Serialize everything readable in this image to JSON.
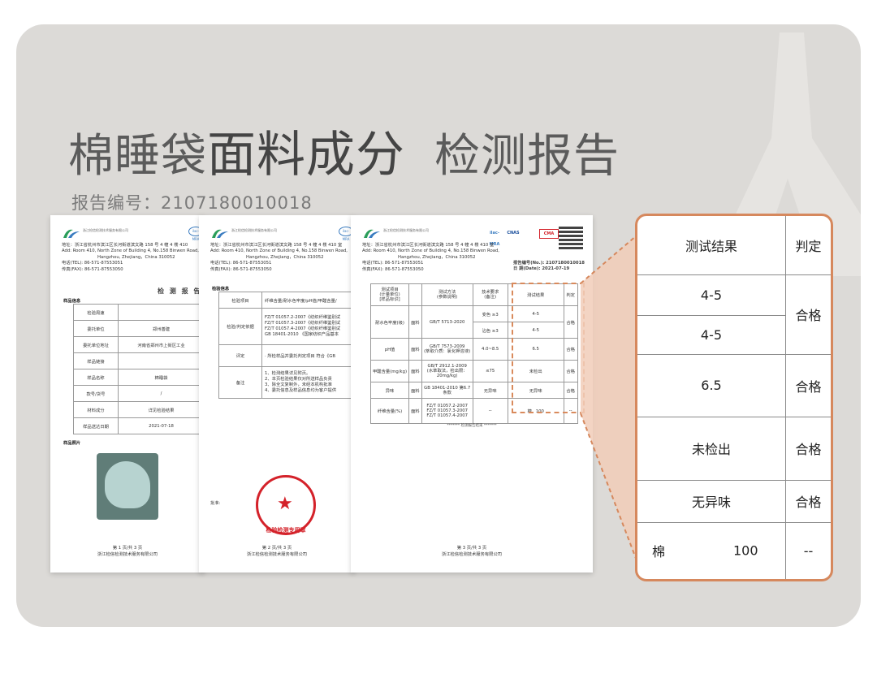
{
  "header": {
    "title_part1": "棉睡袋",
    "title_part2": "面料成分",
    "title_part3": "检测报告",
    "report_number": "报告编号：2107180010018"
  },
  "page1": {
    "lab_name": "浙江检信检测技术服务有限公司",
    "ilac": "ilac-MRA",
    "address_cn": "地址：浙江省杭州市滨江区长河街道滨文路 158 号 4 幢 4 楼 410",
    "address_en1": "Add: Room 410, North Zone of Building 4, No.158 Binwen Road,",
    "address_en2": "Hangzhou, Zhejiang，China      310052",
    "tel": "电话(TEL):     86-571-87553051",
    "fax": "传真(FAX):     86-571-87553050",
    "doc_title": "检 测 报 告",
    "section_sample_info": "样品信息",
    "section_sample_photo": "样品照片",
    "rows": [
      {
        "label": "检验周速",
        "value": ""
      },
      {
        "label": "委托单位",
        "value": "郑州善建"
      },
      {
        "label": "委托单位地址",
        "value": "河南省郑州市上街区工业"
      },
      {
        "label": "样品链接",
        "value": ""
      },
      {
        "label": "样品名称",
        "value": "棉睡袋"
      },
      {
        "label": "款号/货号",
        "value": "/"
      },
      {
        "label": "材料成分",
        "value": "详见检验结果"
      },
      {
        "label": "样品送达日期",
        "value": "2021-07-18"
      }
    ],
    "footer_page": "第 1 页/共 3 页",
    "footer_company": "浙江检信检测技术服务有限公司"
  },
  "page2": {
    "lab_name": "浙江检信检测技术服务有限公司",
    "ilac": "ilac-MRA",
    "address_cn": "地址：浙江省杭州市滨江区长河街道滨文路 158 号 4 幢 4 楼 410 室",
    "address_en1": "Add: Room 410, North Zone of Building 4, No.158 Binwen Road,",
    "address_en2": "Hangzhou, Zhejiang，China      310052",
    "tel": "电话(TEL):     86-571-87553051",
    "fax": "传真(FAX):     86-571-87553050",
    "section_inspect_info": "检验信息",
    "rows": [
      {
        "label": "检验项目",
        "value": "纤维含量/耐水色牢度/pH值/甲醛含量/"
      },
      {
        "label": "检验/判定依据",
        "value": "FZ/T 01057.2-2007《纺织纤维鉴别试\nFZ/T 01057.3-2007《纺织纤维鉴别试\nFZ/T 01057.4-2007《纺织纤维鉴别试\nGB 18401-2010 《国家纺织产品基本"
      },
      {
        "label": "评定",
        "value": "· 所检样品并委托判定项目 符合《GB"
      },
      {
        "label": "备注",
        "value": "1、检测结果详见附页。\n2、本页检验结果仅对所送样品负责\n3、除全文复制外，未经本机构批准\n4、委托信息及样品信息均为客户提供"
      }
    ],
    "approve_label": "批准:",
    "stamp_text": "检验检测专用章",
    "footer_page": "第 2 页/共 3 页",
    "footer_company": "浙江检信检测技术服务有限公司"
  },
  "page3": {
    "lab_name": "浙江检信检测技术服务有限公司",
    "badges": [
      "ilac-MRA",
      "CNAS",
      "CMA"
    ],
    "address_cn": "地址：浙江省杭州市滨江区长河街道滨文路 158 号 4 幢 4 楼 410 室",
    "address_en1": "Add: Room 410, North Zone of Building 4, No.158 Binwen Road,",
    "address_en2": "Hangzhou, Zhejiang，China      310052",
    "tel": "电话(TEL):     86-571-87553051",
    "fax": "传真(FAX):     86-571-87553050",
    "report_no": "报告编号(No.): 2107180010018",
    "date": "日 期(Date): 2021-07-19",
    "columns": [
      "测试项目\n(计量单位)\n[样品标识]",
      "",
      "测试方法\n(参数说明)",
      "技术要求\n(备注)",
      "测试结果",
      "判定"
    ],
    "rows": [
      [
        "耐水色牢度(级)",
        "面料",
        "GB/T 5713-2020",
        "变色 ≥3",
        "4-5",
        "合格"
      ],
      [
        "",
        "",
        "",
        "沾色 ≥3",
        "4-5",
        ""
      ],
      [
        "pH值",
        "面料",
        "GB/T 7573-2009\n(萃取介质：氯化钾溶液)",
        "4.0~8.5",
        "6.5",
        "合格"
      ],
      [
        "甲醛含量(mg/kg)",
        "面料",
        "GB/T 2912.1-2009\n(水萃取法，检出限：20mg/kg)",
        "≤75",
        "未检出",
        "合格"
      ],
      [
        "异味",
        "面料",
        "GB 18401-2010 第6.7条款",
        "无异味",
        "无异味",
        "合格"
      ],
      [
        "纤维含量(%)",
        "面料",
        "FZ/T 01057.2-2007\nFZ/T 01057.3-2007\nFZ/T 01057.4-2007",
        "--",
        "棉   100",
        "--"
      ]
    ],
    "end_note": "******* 检测报告结束 *******",
    "footer_page": "第 3 页/共 3 页",
    "footer_company": "浙江检信检测技术服务有限公司"
  },
  "zoom": {
    "col_result": "测试结果",
    "col_judge": "判定",
    "r1": "4-5",
    "r2": "4-5",
    "judge_12": "合格",
    "r3": "6.5",
    "judge_3": "合格",
    "r4": "未检出",
    "judge_4": "合格",
    "r5": "无异味",
    "judge_5": "合格",
    "r6_fiber": "棉",
    "r6_value": "100",
    "judge_6": "--"
  },
  "colors": {
    "background_card": "#dcdad7",
    "title_text": "#5b5b5b",
    "accent_orange": "#d6885d",
    "stamp_red": "#d4222a"
  }
}
